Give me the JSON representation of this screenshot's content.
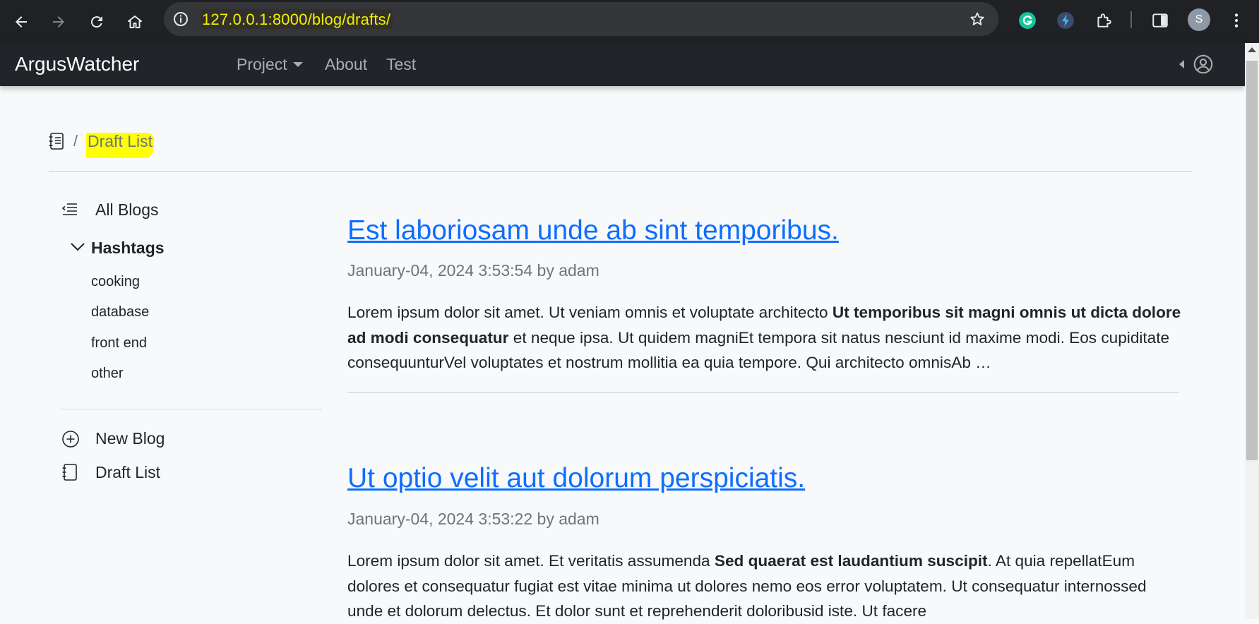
{
  "browser": {
    "url": "127.0.0.1:8000/blog/drafts/",
    "profile_initial": "S"
  },
  "navbar": {
    "brand": "ArgusWatcher",
    "links": [
      "Project",
      "About",
      "Test"
    ]
  },
  "breadcrumb": {
    "separator": "/",
    "current": "Draft List"
  },
  "sidebar": {
    "all_blogs": "All Blogs",
    "hashtags_heading": "Hashtags",
    "tags": [
      "cooking",
      "database",
      "front end",
      "other"
    ],
    "new_blog": "New Blog",
    "draft_list": "Draft List"
  },
  "posts": [
    {
      "title": "Est laboriosam unde ab sint temporibus.",
      "meta": "January-04, 2024 3:53:54 by adam",
      "body_start": "Lorem ipsum dolor sit amet. Ut veniam omnis et voluptate architecto ",
      "body_bold": "Ut temporibus sit magni omnis ut dicta dolore ad modi consequatur",
      "body_end": " et neque ipsa. Ut quidem magniEt tempora sit natus nesciunt id maxime modi. Eos cupiditate consequunturVel voluptates et nostrum mollitia ea quia tempore. Qui architecto omnisAb …"
    },
    {
      "title": "Ut optio velit aut dolorum perspiciatis.",
      "meta": "January-04, 2024 3:53:22 by adam",
      "body_start": "Lorem ipsum dolor sit amet. Et veritatis assumenda ",
      "body_bold": "Sed quaerat est laudantium suscipit",
      "body_end": ". At quia repellatEum dolores et consequatur fugiat est vitae minima ut dolores nemo eos error voluptatem. Ut consequatur internossed unde et dolorum delectus. Et dolor sunt et reprehenderit doloribusid iste. Ut facere"
    }
  ],
  "colors": {
    "navbar_bg": "#212529",
    "link": "#0d6efd",
    "highlight": "#ffff00",
    "url_text": "#f1f100"
  }
}
